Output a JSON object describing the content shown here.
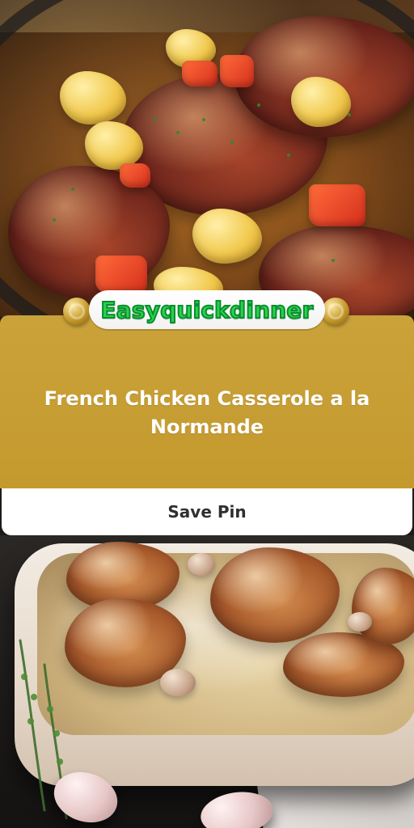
{
  "brand": {
    "name": "Easyquickdinner"
  },
  "recipe": {
    "title": "French Chicken Casserole a la Normande"
  },
  "actions": {
    "save_label": "Save Pin"
  },
  "colors": {
    "banner_gold": "#c7a02f",
    "brand_green": "#29d24c",
    "white": "#ffffff"
  }
}
